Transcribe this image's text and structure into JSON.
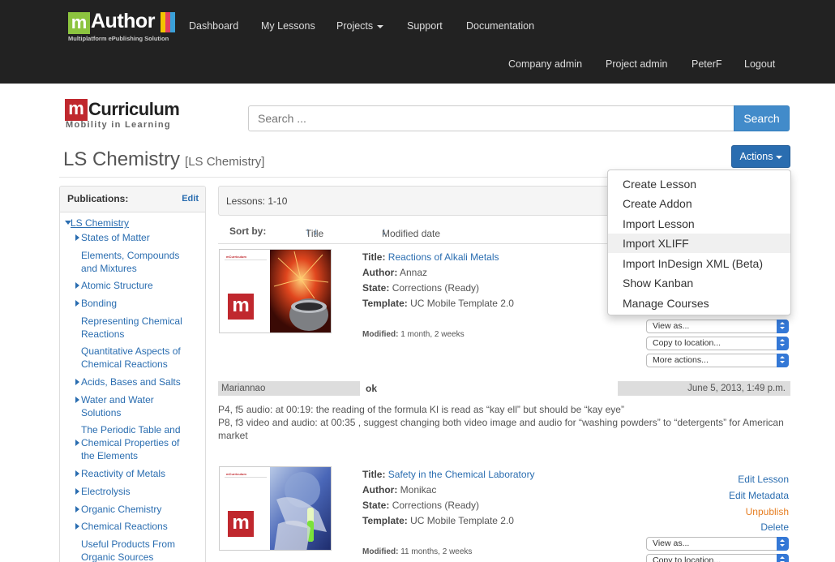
{
  "brand": {
    "logo_letter": "m",
    "logo_word": "Author",
    "tagline": "Multiplatform ePublishing Solution"
  },
  "nav": {
    "primary": [
      "Dashboard",
      "My Lessons",
      "Projects",
      "Support",
      "Documentation"
    ],
    "secondary": [
      "Company admin",
      "Project admin",
      "PeterF",
      "Logout"
    ]
  },
  "org_logo": {
    "letter": "m",
    "word": "Curriculum",
    "tagline": "Mobility in Learning"
  },
  "search": {
    "placeholder": "Search ...",
    "button": "Search"
  },
  "page": {
    "title": "LS Chemistry",
    "subtitle": "[LS Chemistry]",
    "actions_label": "Actions"
  },
  "actions_menu": [
    "Create Lesson",
    "Create Addon",
    "Import Lesson",
    "Import XLIFF",
    "Import InDesign XML (Beta)",
    "Show Kanban",
    "Manage Courses"
  ],
  "sidebar": {
    "title": "Publications:",
    "edit": "Edit",
    "root": "LS Chemistry",
    "items": [
      {
        "label": "States of Matter"
      },
      {
        "label": "Elements, Compounds and Mixtures"
      },
      {
        "label": "Atomic Structure"
      },
      {
        "label": "Bonding"
      },
      {
        "label": "Representing Chemical Reactions"
      },
      {
        "label": "Quantitative Aspects of Chemical Reactions"
      },
      {
        "label": "Acids, Bases and Salts"
      },
      {
        "label": "Water and Water Solutions"
      },
      {
        "label": "The Periodic Table and Chemical Properties of the Elements"
      },
      {
        "label": "Reactivity of Metals"
      },
      {
        "label": "Electrolysis"
      },
      {
        "label": "Organic Chemistry"
      },
      {
        "label": "Chemical Reactions"
      },
      {
        "label": "Useful Products From Organic Sources"
      }
    ]
  },
  "lessons_header": "Lessons: 1-10",
  "sort": {
    "label": "Sort by:",
    "title": "Title",
    "title_arrows": "↑ ↓",
    "modified": "Modified date",
    "modified_arrow": "↓"
  },
  "lessons": [
    {
      "thumb_brand": "mCurriculum",
      "title_label": "Title:",
      "title": "Reactions of Alkali Metals",
      "author_label": "Author:",
      "author": "Annaz",
      "state_label": "State:",
      "state": "Corrections (Ready)",
      "template_label": "Template:",
      "template": "UC Mobile Template 2.0",
      "modified_label": "Modified:",
      "modified": "1 month, 2 weeks",
      "selects": [
        "View as...",
        "Copy to location...",
        "More actions..."
      ]
    },
    {
      "thumb_brand": "mCurriculum",
      "title_label": "Title:",
      "title": "Safety in the Chemical Laboratory",
      "author_label": "Author:",
      "author": "Monikac",
      "state_label": "State:",
      "state": "Corrections (Ready)",
      "template_label": "Template:",
      "template": "UC Mobile Template 2.0",
      "modified_label": "Modified:",
      "modified": "11 months, 2 weeks",
      "links": [
        "Edit Lesson",
        "Edit Metadata",
        "Unpublish",
        "Delete"
      ],
      "selects": [
        "View as...",
        "Copy to location..."
      ]
    }
  ],
  "comment": {
    "user": "Mariannao",
    "status": "ok",
    "date": "June 5, 2013, 1:49 p.m.",
    "line1": "P4, f5 audio: at 00:19: the reading of the formula KI is read as “kay ell” but should be “kay eye”",
    "line2": "P8, f3 video and audio: at 00:35 , suggest changing both video image and audio for “washing powders” to “detergents” for American market"
  },
  "colors": {
    "topbar": "#222222",
    "link": "#2a6db0",
    "primary": "#428bca",
    "brand_green": "#8cc43f",
    "brand_red": "#c0282e",
    "unpublish": "#e67e22"
  }
}
